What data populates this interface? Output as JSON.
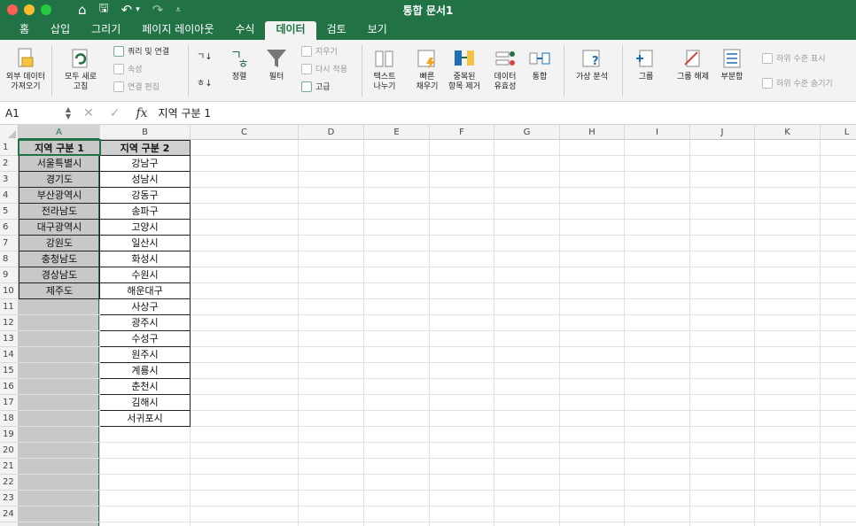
{
  "window": {
    "title": "통합 문서1"
  },
  "qat": {
    "home": "⌂",
    "save": "🖫",
    "undo": "↶",
    "undo_drop": "▾",
    "redo": "↷",
    "customize": "⩡"
  },
  "tabs": [
    "홈",
    "삽입",
    "그리기",
    "페이지 레이아웃",
    "수식",
    "데이터",
    "검토",
    "보기"
  ],
  "active_tab": "데이터",
  "ribbon": {
    "external_data": "외부 데이터\n가져오기",
    "refresh_all": "모두 새로\n고침",
    "queries_connections": "쿼리 및 연결",
    "properties": "속성",
    "edit_links": "연결 편집",
    "sort_asc": "ㄱ↓",
    "sort_desc": "ㅎ↓",
    "sort": "정렬",
    "filter": "필터",
    "clear": "지우기",
    "reapply": "다시 적용",
    "advanced": "고급",
    "text_to_columns": "텍스트\n나누기",
    "flash_fill": "빠른\n채우기",
    "remove_duplicates": "중복된\n항목 제거",
    "data_validation": "데이터\n유효성",
    "consolidate": "통합",
    "what_if": "가상 분석",
    "group": "그룹",
    "ungroup": "그룹 해제",
    "subtotal": "부분합",
    "show_detail": "하위 수준 표시",
    "hide_detail": "하위 수준 숨기기"
  },
  "formula_bar": {
    "name_box": "A1",
    "cancel": "✕",
    "enter": "✓",
    "fx": "fx",
    "value": "지역 구분 1"
  },
  "columns": [
    "A",
    "B",
    "C",
    "D",
    "E",
    "F",
    "G",
    "H",
    "I",
    "J",
    "K",
    "L"
  ],
  "rows": [
    "1",
    "2",
    "3",
    "4",
    "5",
    "6",
    "7",
    "8",
    "9",
    "10",
    "11",
    "12",
    "13",
    "14",
    "15",
    "16",
    "17",
    "18",
    "19",
    "20",
    "21",
    "22",
    "23",
    "24",
    "25"
  ],
  "sheet": {
    "colA": [
      "지역 구분 1",
      "서울특별시",
      "경기도",
      "부산광역시",
      "전라남도",
      "대구광역시",
      "강원도",
      "충청남도",
      "경상남도",
      "제주도"
    ],
    "colB": [
      "지역 구분 2",
      "강남구",
      "성남시",
      "강동구",
      "송파구",
      "고양시",
      "일산시",
      "화성시",
      "수원시",
      "해운대구",
      "사상구",
      "광주시",
      "수성구",
      "원주시",
      "계룡시",
      "춘천시",
      "김해시",
      "서귀포시"
    ]
  }
}
